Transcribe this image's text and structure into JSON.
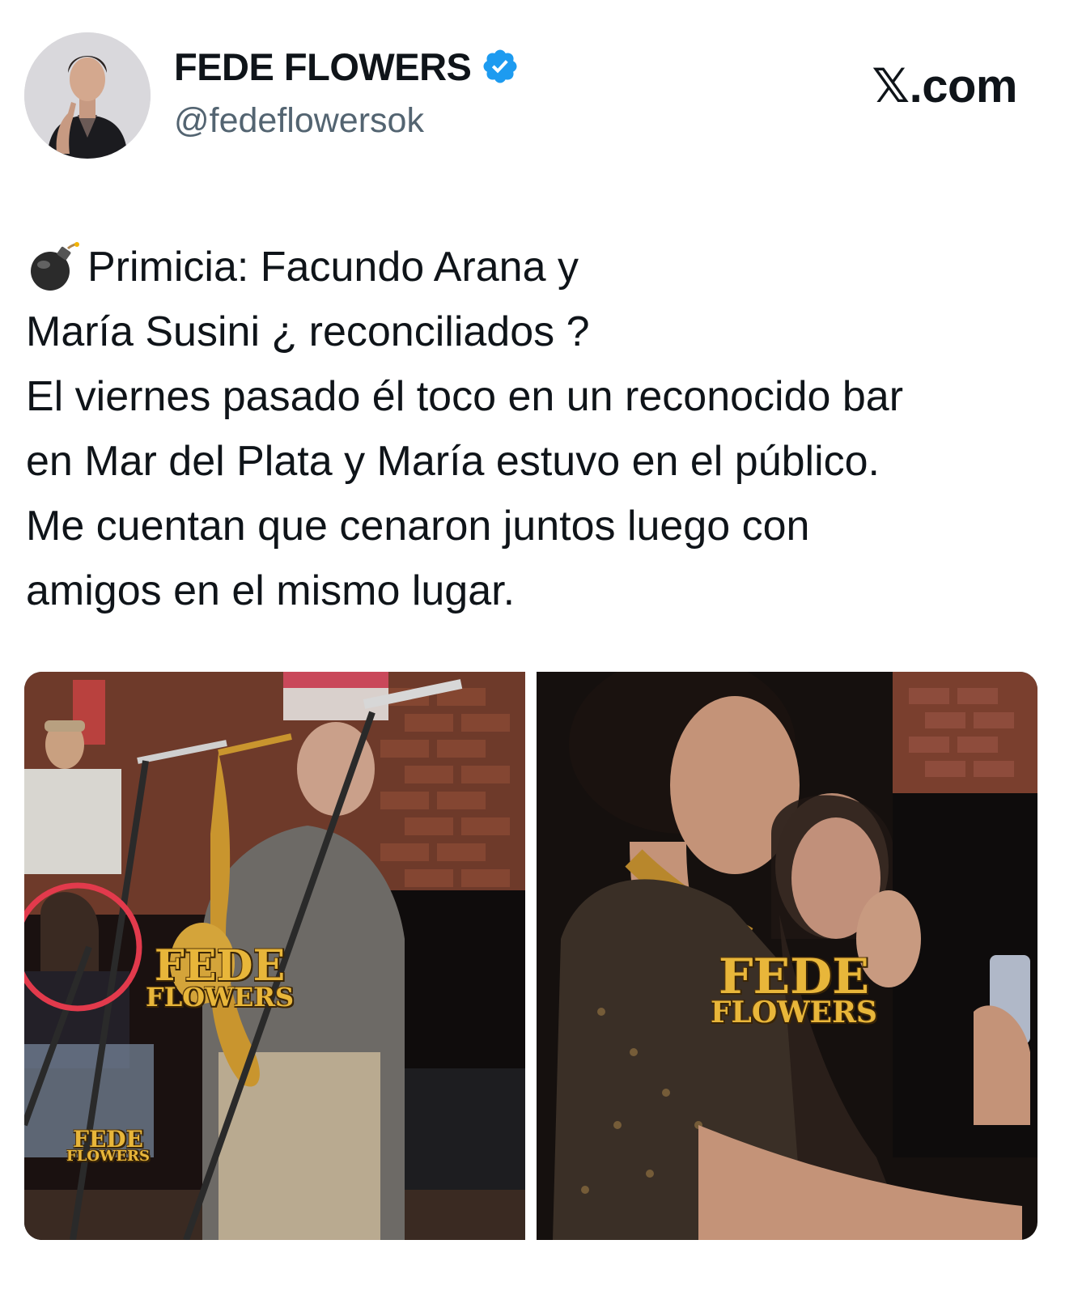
{
  "header": {
    "display_name": "FEDE FLOWERS",
    "handle": "@fedeflowersok",
    "brand": "𝕏.com"
  },
  "tweet": {
    "lines": [
      "Primicia: Facundo Arana y",
      "María Susini ¿ reconciliados ?",
      "El viernes pasado él toco en un reconocido bar",
      "en Mar del Plata y María estuvo en el público.",
      "Me cuentan que cenaron juntos luego con",
      "amigos en el mismo lugar."
    ],
    "leading_icon": "bomb-icon"
  },
  "media": {
    "left": {
      "watermark_main": [
        "FEDE",
        "FLOWERS"
      ],
      "watermark_small": [
        "FEDE",
        "FLOWERS"
      ]
    },
    "right": {
      "watermark_main": [
        "FEDE",
        "FLOWERS"
      ]
    }
  },
  "colors": {
    "verified": "#1d9bf0",
    "handle": "#536471",
    "watermark": "#e8b63a",
    "highlight_circle": "#e23a4c"
  }
}
